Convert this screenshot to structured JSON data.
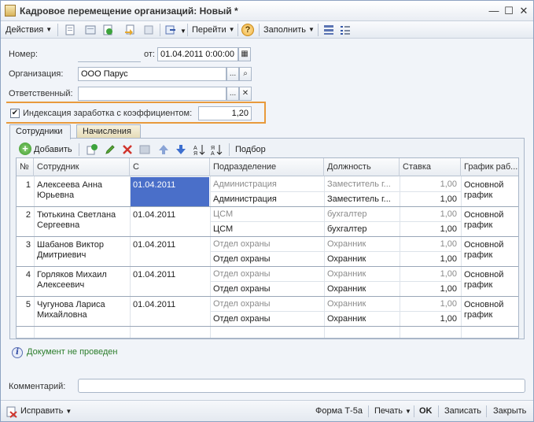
{
  "window": {
    "title": "Кадровое перемещение организаций: Новый *"
  },
  "toolbar": {
    "actions": "Действия",
    "goto": "Перейти",
    "help": "?",
    "fill": "Заполнить"
  },
  "form": {
    "number_label": "Номер:",
    "number_value": "",
    "date_label": "от:",
    "date_value": "01.04.2011 0:00:00",
    "org_label": "Организация:",
    "org_value": "ООО Парус",
    "resp_label": "Ответственный:",
    "resp_value": "",
    "index_label": "Индексация заработка с коэффициентом:",
    "index_checked": true,
    "index_value": "1,20"
  },
  "tabs": [
    {
      "label": "Сотрудники",
      "active": true
    },
    {
      "label": "Начисления",
      "active": false
    }
  ],
  "table_toolbar": {
    "add": "Добавить",
    "pick": "Подбор"
  },
  "table": {
    "columns": [
      "№",
      "Сотрудник",
      "С",
      "Подразделение",
      "Должность",
      "Ставка",
      "График раб..."
    ],
    "rows": [
      {
        "n": "1",
        "employee": "Алексеева Анна\nЮрьевна",
        "emp1": "Алексеева Анна",
        "emp2": "Юрьевна",
        "from": "01.04.2011",
        "dept_old": "Администрация",
        "dept_new": "Администрация",
        "pos_old": "Заместитель г...",
        "pos_new": "Заместитель г...",
        "rate_old": "1,00",
        "rate_new": "1,00",
        "sched1": "Основной",
        "sched2": "график"
      },
      {
        "n": "2",
        "emp1": "Тютькина Светлана",
        "emp2": "Сергеевна",
        "from": "01.04.2011",
        "dept_old": "ЦСМ",
        "dept_new": "ЦСМ",
        "pos_old": "бухгалтер",
        "pos_new": "бухгалтер",
        "rate_old": "1,00",
        "rate_new": "1,00",
        "sched1": "Основной",
        "sched2": "график"
      },
      {
        "n": "3",
        "emp1": "Шабанов Виктор",
        "emp2": "Дмитриевич",
        "from": "01.04.2011",
        "dept_old": "Отдел охраны",
        "dept_new": "Отдел охраны",
        "pos_old": "Охранник",
        "pos_new": "Охранник",
        "rate_old": "1,00",
        "rate_new": "1,00",
        "sched1": "Основной",
        "sched2": "график"
      },
      {
        "n": "4",
        "emp1": "Горляков Михаил",
        "emp2": "Алексеевич",
        "from": "01.04.2011",
        "dept_old": "Отдел охраны",
        "dept_new": "Отдел охраны",
        "pos_old": "Охранник",
        "pos_new": "Охранник",
        "rate_old": "1,00",
        "rate_new": "1,00",
        "sched1": "Основной",
        "sched2": "график"
      },
      {
        "n": "5",
        "emp1": "Чугунова Лариса",
        "emp2": "Михайловна",
        "from": "01.04.2011",
        "dept_old": "Отдел охраны",
        "dept_new": "Отдел охраны",
        "pos_old": "Охранник",
        "pos_new": "Охранник",
        "rate_old": "1,00",
        "rate_new": "1,00",
        "sched1": "Основной",
        "sched2": "график"
      }
    ]
  },
  "status": {
    "text": "Документ не проведен"
  },
  "comment": {
    "label": "Комментарий:",
    "value": ""
  },
  "bottom": {
    "edit": "Исправить",
    "form_t5a": "Форма Т-5а",
    "print": "Печать",
    "ok": "OK",
    "save": "Записать",
    "close": "Закрыть"
  },
  "colors": {
    "highlight": "#e89a3c",
    "selection": "#4a6fc9",
    "status_green": "#2b7d2b"
  }
}
